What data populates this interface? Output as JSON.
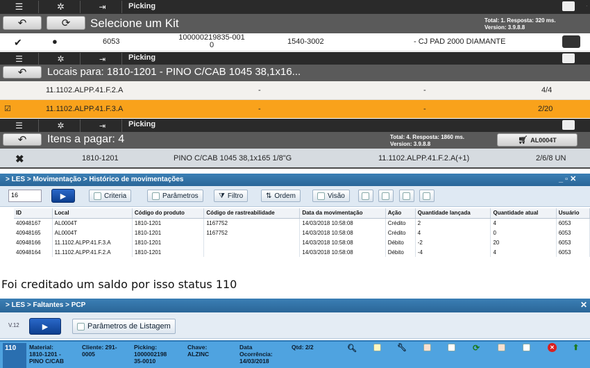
{
  "top1": {
    "label": "Picking"
  },
  "kit": {
    "title": "Selecione um Kit",
    "meta_line1": "Total: 1. Resposta: 320 ms.",
    "meta_line2": "Version: 3.9.8.8",
    "row": {
      "num": "6053",
      "code_line1": "100000219835-001",
      "code_line2": "0",
      "ref": "1540-3002",
      "desc": "- CJ PAD 2000 DIAMANTE"
    }
  },
  "top2": {
    "label": "Picking"
  },
  "locais": {
    "title": "Locais para: 1810-1201 - PINO C/CAB 1045 38,1x16...",
    "rows": [
      {
        "loc": "11.1102.ALPP.41.F.2.A",
        "c1": "-",
        "c2": "-",
        "qty": "4/4"
      },
      {
        "loc": "11.1102.ALPP.41.F.3.A",
        "c1": "-",
        "c2": "-",
        "qty": "2/20"
      }
    ]
  },
  "top3": {
    "label": "Picking"
  },
  "itens": {
    "title": "Itens a pagar: 4",
    "meta_line1": "Total: 4. Resposta: 1860 ms.",
    "meta_line2": "Version: 3.9.8.8",
    "cart_label": "AL0004T",
    "row": {
      "code": "1810-1201",
      "desc": "PINO C/CAB 1045 38,1x165 1/8\"G",
      "loc": "11.1102.ALPP.41.F.2.A(+1)",
      "qty": "2/6/8 UN"
    }
  },
  "les1": {
    "breadcrumb": "> LES > Movimentação > Histórico de movimentações",
    "page_size": "16",
    "buttons": {
      "criteria": "Criteria",
      "params": "Parâmetros",
      "filtro": "Filtro",
      "ordem": "Ordem",
      "visao": "Visão"
    },
    "columns": [
      "ID",
      "Local",
      "Código do produto",
      "Código de rastreabilidade",
      "Data da movimentação",
      "Ação",
      "Quantidade lançada",
      "Quantidade atual",
      "Usuário"
    ],
    "rows": [
      [
        "40948167",
        "AL0004T",
        "1810-1201",
        "1167752",
        "14/03/2018 10:58:08",
        "Crédito",
        "2",
        "4",
        "6053"
      ],
      [
        "40948165",
        "AL0004T",
        "1810-1201",
        "1167752",
        "14/03/2018 10:58:08",
        "Crédito",
        "4",
        "0",
        "6053"
      ],
      [
        "40948166",
        "11.1102.ALPP.41.F.3.A",
        "1810-1201",
        "",
        "14/03/2018 10:58:08",
        "Débito",
        "-2",
        "20",
        "6053"
      ],
      [
        "40948164",
        "11.1102.ALPP.41.F.2.A",
        "1810-1201",
        "",
        "14/03/2018 10:58:08",
        "Débito",
        "-4",
        "4",
        "6053"
      ]
    ]
  },
  "note": "Foi creditado um saldo por isso status 110",
  "les2": {
    "breadcrumb": "> LES > Faltantes > PCP",
    "version": "V.12",
    "params_button": "Parâmetros de Listagem",
    "row": {
      "status": "110",
      "material_label": "Material:",
      "material_value": "1810-1201 -",
      "material_value2": "PINO C/CAB",
      "cliente_label": "Cliente: 291-",
      "cliente_value": "0005",
      "picking_label": "Picking:",
      "picking_value": "1000002198",
      "picking_value2": "35-0010",
      "chave_label": "Chave:",
      "chave_value": "ALZINC",
      "data_label": "Data",
      "data_label2": "Ocorrência:",
      "data_value": "14/03/2018",
      "qtd": "Qtd: 2/2"
    }
  },
  "colors": {
    "orange": "#f9a21b",
    "topbar": "#2a2a2a",
    "titlebar": "#5a5a5a",
    "les_blue": "#2a6698",
    "row_blue": "#4fa3e0"
  }
}
